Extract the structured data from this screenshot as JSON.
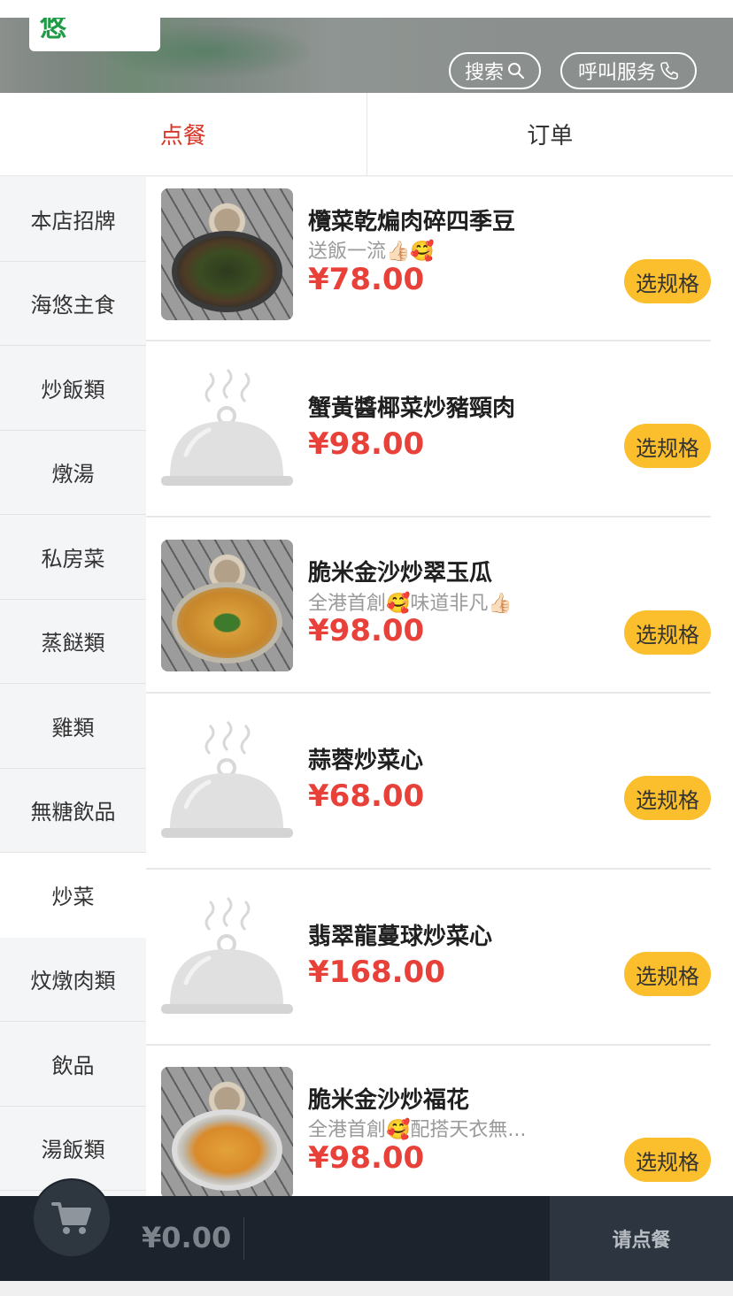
{
  "header": {
    "search_label": "搜索",
    "call_label": "呼叫服务",
    "search_icon": "search-icon",
    "call_icon": "phone-icon"
  },
  "tabs": [
    {
      "label": "点餐",
      "active": true
    },
    {
      "label": "订单",
      "active": false
    }
  ],
  "sidebar": {
    "items": [
      {
        "label": "本店招牌"
      },
      {
        "label": "海悠主食"
      },
      {
        "label": "炒飯類"
      },
      {
        "label": "燉湯"
      },
      {
        "label": "私房菜"
      },
      {
        "label": "蒸餸類"
      },
      {
        "label": "雞類"
      },
      {
        "label": "無糖飲品"
      },
      {
        "label": "炒菜",
        "active": true
      },
      {
        "label": "炆燉肉類"
      },
      {
        "label": "飲品"
      },
      {
        "label": "湯飯類"
      }
    ]
  },
  "dishes": [
    {
      "name": "欖菜乾煸肉碎四季豆",
      "desc": "送飯一流👍🏻🥰",
      "price": "¥78.00",
      "button": "选规格",
      "image": "photo-green-beans"
    },
    {
      "name": "蟹黃醬椰菜炒豬頸肉",
      "desc": "",
      "price": "¥98.00",
      "button": "选规格",
      "image": "placeholder-cloche-icon"
    },
    {
      "name": "脆米金沙炒翠玉瓜",
      "desc": "全港首創🥰味道非凡👍🏻",
      "price": "¥98.00",
      "button": "选规格",
      "image": "photo-zucchini"
    },
    {
      "name": "蒜蓉炒菜心",
      "desc": "",
      "price": "¥68.00",
      "button": "选规格",
      "image": "placeholder-cloche-icon"
    },
    {
      "name": "翡翠龍蔓球炒菜心",
      "desc": "",
      "price": "¥168.00",
      "button": "选规格",
      "image": "placeholder-cloche-icon"
    },
    {
      "name": "脆米金沙炒福花",
      "desc": "全港首創🥰配搭天衣無...",
      "price": "¥98.00",
      "button": "选规格",
      "image": "photo-cauliflower"
    }
  ],
  "cart": {
    "total": "¥0.00",
    "order_label": "请点餐",
    "icon": "cart-icon"
  },
  "colors": {
    "accent_red": "#e8413a",
    "button_yellow": "#fbbf2d",
    "cart_bar": "#1d232c"
  }
}
